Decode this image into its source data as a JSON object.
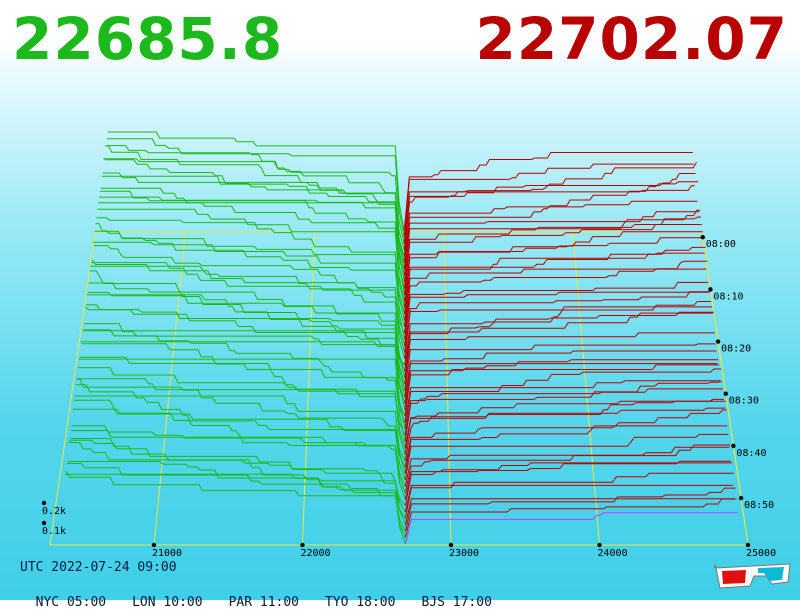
{
  "bid_price": "22685.8",
  "ask_price": "22702.07",
  "footer": {
    "utc": "UTC 2022-07-24 09:00",
    "zones": [
      "NYC 05:00",
      "LON 10:00",
      "PAR 11:00",
      "TYO 18:00",
      "BJS 17:00"
    ]
  },
  "colors": {
    "bid": "#1cb91c",
    "ask": "#b80000",
    "grid": "#e8e840",
    "latest_ask": "#c040ff"
  },
  "icons": {
    "mode": "3d-glasses-icon"
  },
  "chart_data": {
    "type": "line",
    "subtype": "3d-order-book-depth-waterfall",
    "x_label": "",
    "price_ticks": [
      21000,
      22000,
      23000,
      24000,
      25000
    ],
    "price_range": [
      20300,
      25000
    ],
    "depth_ticks": [
      "0.1k",
      "0.2k"
    ],
    "time_ticks": [
      "08:00",
      "08:10",
      "08:20",
      "08:30",
      "08:40",
      "08:50"
    ],
    "series": [
      {
        "name": "",
        "side": "bid",
        "mid_price": 22685.8
      },
      {
        "name": "",
        "side": "ask",
        "mid_price": 22702.07
      }
    ]
  }
}
